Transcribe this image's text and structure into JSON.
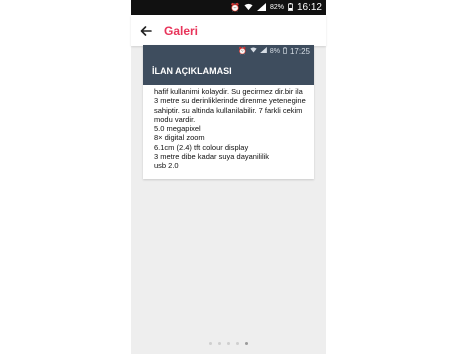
{
  "status_bar": {
    "battery": "82%",
    "time": "16:12"
  },
  "app_bar": {
    "title": "Galeri"
  },
  "screenshot": {
    "status_bar": {
      "battery": "8%",
      "time": "17:25"
    },
    "header": "İLAN AÇIKLAMASI",
    "description": "hafif kullanimi kolaydir. Su gecirmez dir.bir ila 3 metre su derinliklerinde direnme yetenegine sahiptir. su altinda kullanilabilir. 7 farkli cekim modu vardir.\n5.0  megapixel\n8× digital zoom\n6.1cm (2.4) tft colour display\n3 metre dibe kadar suya dayanililik\nusb 2.0"
  },
  "pager": {
    "count": 5,
    "active_index": 4
  },
  "colors": {
    "accent": "#e8345a",
    "header_bg": "#3e4d5e",
    "status_bg": "#111111"
  }
}
